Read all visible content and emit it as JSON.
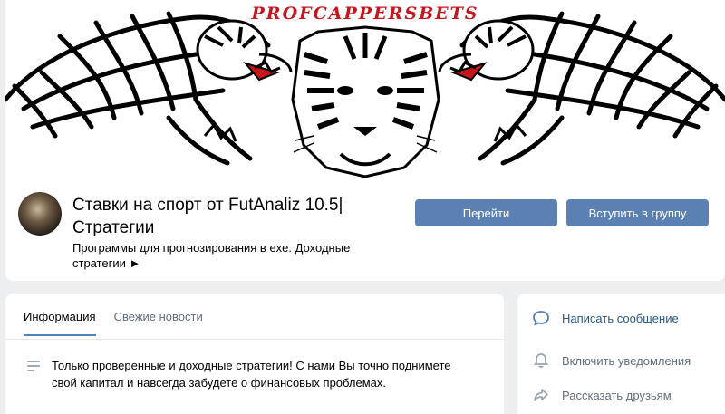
{
  "cover": {
    "brand_text": "PROFCAPPERSBETS"
  },
  "group": {
    "title": "Ставки на спорт от FutAnaliz 10.5| Стратегии",
    "status": "Программы для прогнозирования в exe. Доходные стратегии ►"
  },
  "buttons": {
    "go_label": "Перейти",
    "join_label": "Вступить в группу"
  },
  "tabs": [
    {
      "label": "Информация",
      "active": true
    },
    {
      "label": "Свежие новости",
      "active": false
    }
  ],
  "description": "Только проверенные и доходные стратегии! С нами Вы точно поднимете свой капитал и навсегда забудете о финансовых проблемах.",
  "actions": [
    {
      "label": "Написать сообщение",
      "icon": "message-icon"
    },
    {
      "label": "Включить уведомления",
      "icon": "bell-icon"
    },
    {
      "label": "Рассказать друзьям",
      "icon": "share-icon"
    }
  ],
  "colors": {
    "accent": "#5b80b2",
    "link": "#2a5885",
    "brand_red": "#c8141c",
    "background": "#edeef0"
  }
}
